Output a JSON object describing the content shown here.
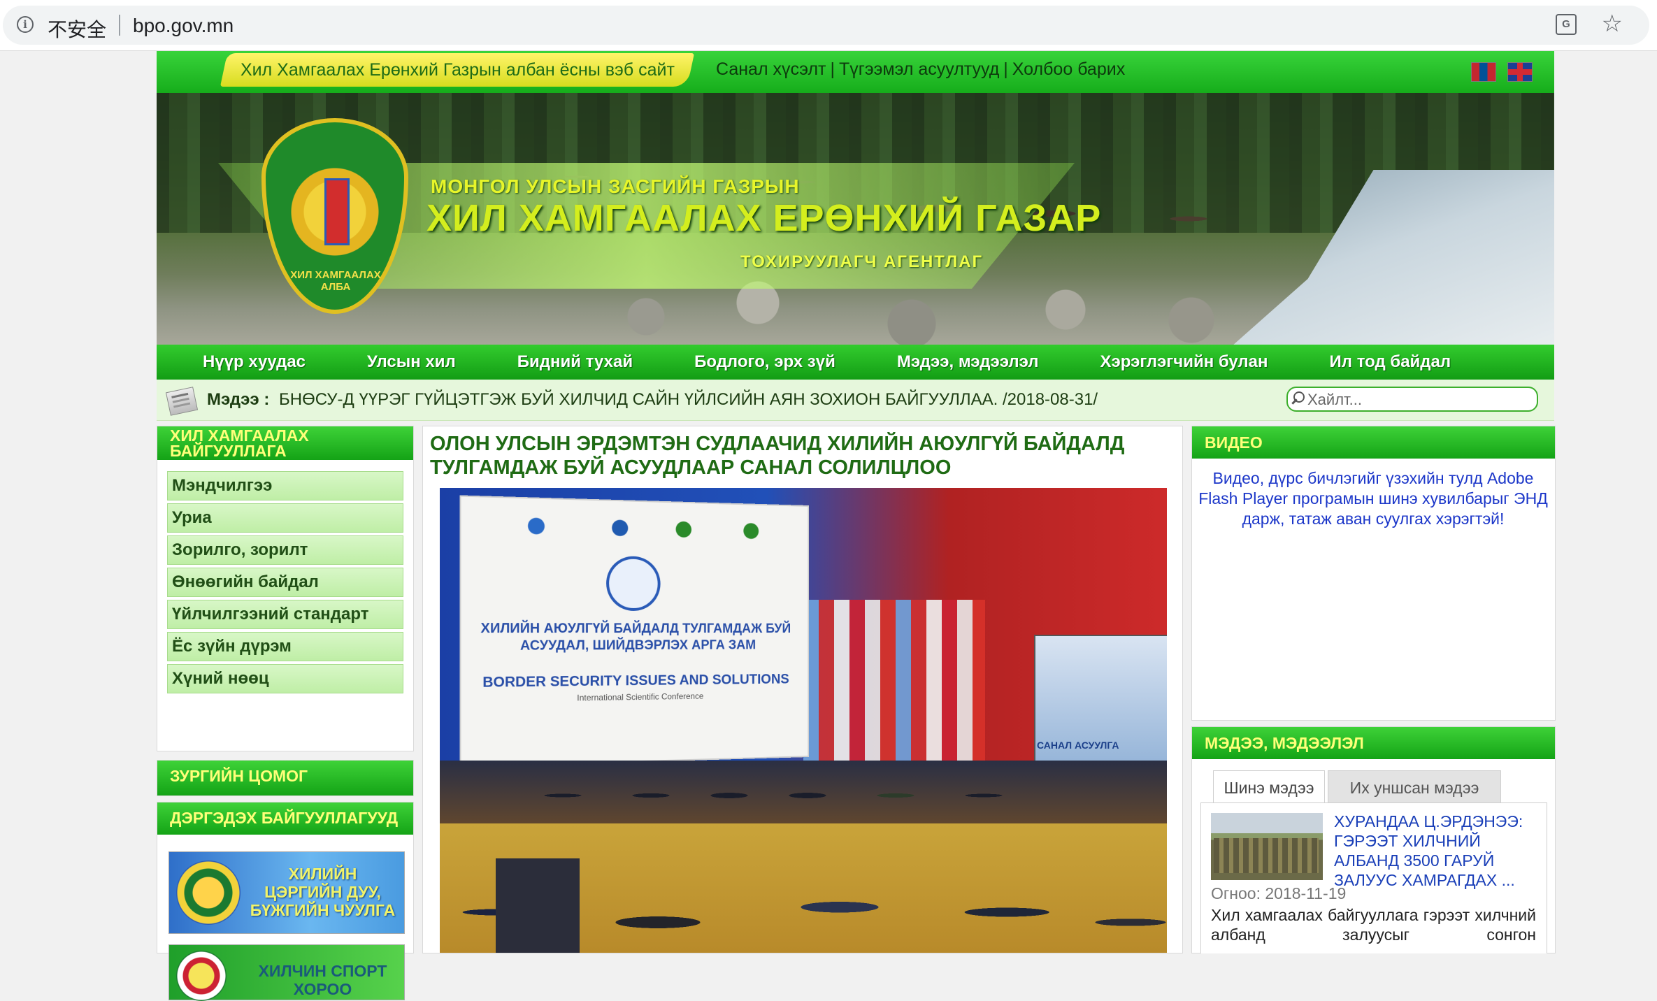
{
  "browser": {
    "security_label": "不安全",
    "url": "bpo.gov.mn"
  },
  "topbar": {
    "official_site": "Хил Хамгаалах Ерөнхий Газрын албан ёсны вэб сайт",
    "links": [
      "Санал хүсэлт",
      "Түгээмэл асуултууд",
      "Холбоо барих"
    ]
  },
  "banner": {
    "line1": "МОНГОЛ УЛСЫН ЗАСГИЙН ГАЗРЫН",
    "line2": "ХИЛ ХАМГААЛАХ ЕРӨНХИЙ ГАЗАР",
    "line3": "ТОХИРУУЛАГЧ АГЕНТЛАГ",
    "emblem_text": "ХИЛ ХАМГААЛАХ АЛБА"
  },
  "nav": [
    "Нүүр хуудас",
    "Улсын хил",
    "Бидний тухай",
    "Бодлого, эрх зүй",
    "Мэдээ, мэдээлэл",
    "Хэрэглэгчийн булан",
    "Ил тод байдал"
  ],
  "ticker": {
    "label": "Мэдээ :",
    "text": "БНӨСУ-Д ҮҮРЭГ ГҮЙЦЭТГЭЖ БУЙ ХИЛЧИД САЙН ҮЙЛСИЙН АЯН ЗОХИОН БАЙГУУЛЛАА. /2018-08-31/",
    "search_placeholder": "Хайлт..."
  },
  "left": {
    "org_title": "ХИЛ ХАМГААЛАХ БАЙГУУЛЛАГА",
    "org_items": [
      "Мэндчилгээ",
      "Уриа",
      "Зорилго, зорилт",
      "Өнөөгийн байдал",
      "Үйлчилгээний стандарт",
      "Ёс зүйн дүрэм",
      "Хүний нөөц"
    ],
    "photo_album": "ЗУРГИЙН ЦОМОГ",
    "affiliates_title": "ДЭРГЭДЭХ БАЙГУУЛЛАГУУД",
    "promo1": "ХИЛИЙН ЦЭРГИЙН ДУУ, БҮЖГИЙН ЧУУЛГА",
    "promo2": "ХИЛЧИН СПОРТ ХОРОО"
  },
  "article": {
    "title": "ОЛОН УЛСЫН ЭРДЭМТЭН СУДЛААЧИД ХИЛИЙН АЮУЛГҮЙ БАЙДАЛД ТУЛГАМДАЖ БУЙ АСУУДЛААР САНАЛ СОЛИЛЦЛОО",
    "board_line1": "ХИЛИЙН АЮУЛГҮЙ БАЙДАЛД ТУЛГАМДАЖ БУЙ АСУУДАЛ, ШИЙДВЭРЛЭХ АРГА ЗАМ",
    "board_line2": "BORDER SECURITY ISSUES AND SOLUTIONS",
    "board_line3": "International Scientific Conference",
    "screen_text": "САНАЛ АСУУЛГА"
  },
  "right": {
    "video_title": "ВИДЕО",
    "video_text": "Видео, дүрс бичлэгийг үзэхийн тулд Adobe Flash Player програмын шинэ хувилбарыг ЭНД дарж, татаж аван суулгах хэрэгтэй!",
    "news_title": "МЭДЭЭ, МЭДЭЭЛЭЛ",
    "tab_new": "Шинэ мэдээ",
    "tab_popular": "Их уншсан мэдээ",
    "item_title": "ХУРАНДАА Ц.ЭРДЭНЭЭ: ГЭРЭЭТ ХИЛЧНИЙ АЛБАНД 3500 ГАРУЙ ЗАЛУУС ХАМРАГДАХ ...",
    "item_date": "Огноо: 2018-11-19",
    "item_excerpt": "Хил хамгаалах байгууллага гэрээт хилчний албанд залуусыг сонгон"
  },
  "colors": {
    "green_bar": "#16ad1b",
    "header_text_yellow": "#ffff7a",
    "link_blue": "#1c37c9"
  }
}
